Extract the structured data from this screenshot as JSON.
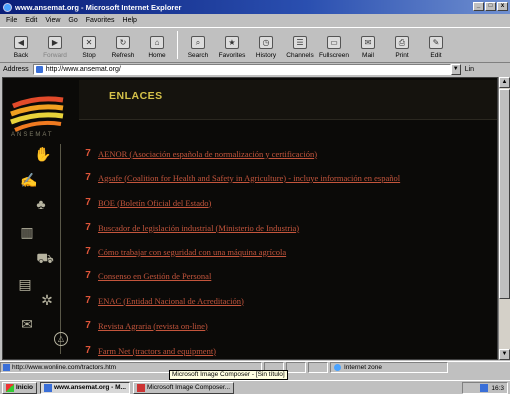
{
  "window": {
    "title": "www.ansemat.org - Microsoft Internet Explorer"
  },
  "menu": [
    "File",
    "Edit",
    "View",
    "Go",
    "Favorites",
    "Help"
  ],
  "toolbar": [
    {
      "label": "Back",
      "icon": "back-arrow-icon"
    },
    {
      "label": "Forward",
      "icon": "forward-arrow-icon"
    },
    {
      "label": "Stop",
      "icon": "stop-icon"
    },
    {
      "label": "Refresh",
      "icon": "refresh-icon"
    },
    {
      "label": "Home",
      "icon": "home-icon"
    },
    {
      "label": "Search",
      "icon": "search-icon"
    },
    {
      "label": "Favorites",
      "icon": "favorites-icon"
    },
    {
      "label": "History",
      "icon": "history-icon"
    },
    {
      "label": "Channels",
      "icon": "channels-icon"
    },
    {
      "label": "Fullscreen",
      "icon": "fullscreen-icon"
    },
    {
      "label": "Mail",
      "icon": "mail-icon"
    },
    {
      "label": "Print",
      "icon": "print-icon"
    },
    {
      "label": "Edit",
      "icon": "edit-icon"
    }
  ],
  "address": {
    "label": "Address",
    "value": "http://www.ansemat.org/",
    "links_label": "Lin"
  },
  "page": {
    "heading": "ENLACES",
    "logo_text": "ANSEMAT",
    "links": [
      "AENOR (Asociación española de normalización y certificación)",
      "Agsafe (Coalition for Health and Safety in Agriculture) - incluye información en español",
      "BOE (Boletín Oficial del Estado)",
      "Buscador de legislación industrial (Ministerio de Industria)",
      "Cómo trabajar con seguridad con una máquina agrícola",
      "Consenso en Gestión de Personal",
      "ENAC (Entidad Nacional de Acreditación)",
      "Revista Agraria (revista on-line)",
      "Farm Net (tractors and equipment)"
    ]
  },
  "status": {
    "url": "http://www.wonline.com/tractors.htm",
    "zone": "Internet zone"
  },
  "tooltip": "Microsoft Image Composer - [Sin título]",
  "taskbar": {
    "start": "Inicio",
    "tasks": [
      "www.ansemat.org - M...",
      "Microsoft Image Composer..."
    ],
    "clock": "16:3"
  }
}
